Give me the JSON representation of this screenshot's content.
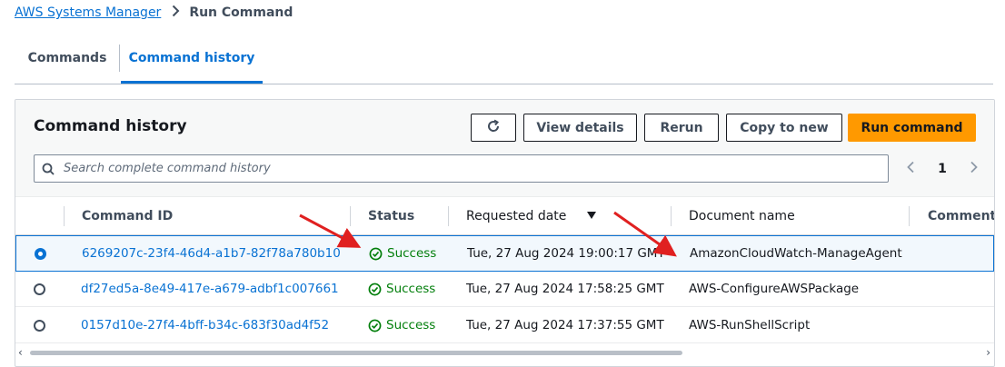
{
  "breadcrumb": {
    "parent": "AWS Systems Manager",
    "current": "Run Command"
  },
  "tabs": [
    {
      "label": "Commands"
    },
    {
      "label": "Command history"
    }
  ],
  "panel": {
    "title": "Command history",
    "buttons": {
      "view": "View details",
      "rerun": "Rerun",
      "copy": "Copy to new",
      "run": "Run command"
    },
    "search": {
      "placeholder": "Search complete command history",
      "value": ""
    },
    "pager": {
      "current_page": "1"
    }
  },
  "table": {
    "columns": [
      "Command ID",
      "Status",
      "Requested date",
      "Document name",
      "Comment"
    ],
    "sorted_column": "Requested date",
    "sort_direction": "descending",
    "rows": [
      {
        "id": "6269207c-23f4-46d4-a1b7-82f78a780b10",
        "status": "Success",
        "date": "Tue, 27 Aug 2024 19:00:17 GMT",
        "document": "AmazonCloudWatch-ManageAgent",
        "selected": true
      },
      {
        "id": "df27ed5a-8e49-417e-a679-adbf1c007661",
        "status": "Success",
        "date": "Tue, 27 Aug 2024 17:58:25 GMT",
        "document": "AWS-ConfigureAWSPackage",
        "selected": false
      },
      {
        "id": "0157d10e-27f4-4bff-b34c-683f30ad4f52",
        "status": "Success",
        "date": "Tue, 27 Aug 2024 17:37:55 GMT",
        "document": "AWS-RunShellScript",
        "selected": false
      }
    ]
  },
  "colors": {
    "accent": "#0972d3",
    "primary_button": "#ff9900",
    "success": "#037f0c",
    "annotation_arrow": "#e02020"
  },
  "icons": {
    "refresh": "refresh-icon",
    "search": "search-icon",
    "status": "check-circle-icon",
    "sort": "sort-down-icon"
  }
}
